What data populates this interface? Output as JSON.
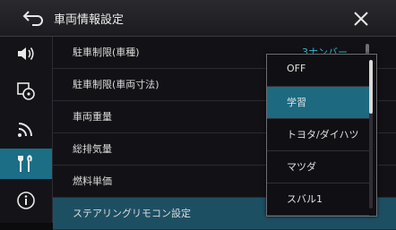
{
  "header": {
    "title": "車両情報設定",
    "back_icon": "back-arrow-icon",
    "close_icon": "close-icon"
  },
  "sidebar": {
    "items": [
      {
        "icon": "speaker-icon",
        "active": false
      },
      {
        "icon": "audio-source-icon",
        "active": false
      },
      {
        "icon": "signal-icon",
        "active": false
      },
      {
        "icon": "tools-icon",
        "active": true
      },
      {
        "icon": "info-icon",
        "active": false
      }
    ]
  },
  "settings": {
    "rows": [
      {
        "label": "駐車制限(車種)",
        "value": "3ナンバー"
      },
      {
        "label": "駐車制限(車両寸法)",
        "value": ""
      },
      {
        "label": "車両重量",
        "value": ""
      },
      {
        "label": "総排気量",
        "value": ""
      },
      {
        "label": "燃料単価",
        "value": ""
      },
      {
        "label": "ステアリングリモコン設定",
        "value": ""
      }
    ]
  },
  "dropdown": {
    "options": [
      "OFF",
      "学習",
      "トヨタ/ダイハツ",
      "マツダ",
      "スバル1"
    ],
    "selected": "学習"
  },
  "colors": {
    "accent": "#1d6a80",
    "value_text": "#2fc2d8"
  }
}
